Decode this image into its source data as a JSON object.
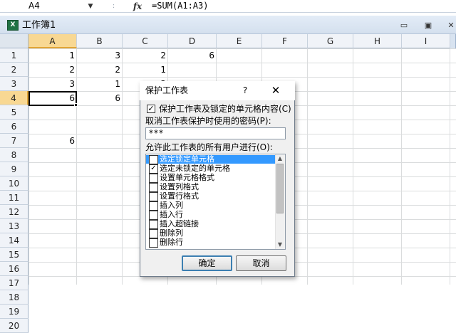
{
  "formula_bar": {
    "name_box": "A4",
    "name_box_arrow": "▼",
    "separator": ":",
    "fx_label": "fx",
    "formula": "=SUM(A1:A3)"
  },
  "window": {
    "title": "工作簿1",
    "icon_letter": "X",
    "minimize": "▭",
    "maximize": "▣",
    "close": "✕"
  },
  "sheet": {
    "columns": [
      "A",
      "B",
      "C",
      "D",
      "E",
      "F",
      "G",
      "H",
      "I"
    ],
    "rows": [
      "1",
      "2",
      "3",
      "4",
      "5",
      "6",
      "7",
      "8",
      "9",
      "10",
      "11",
      "12",
      "13",
      "14",
      "15",
      "16",
      "17",
      "18",
      "19",
      "20"
    ],
    "active_column": "A",
    "active_row": "4",
    "cells": {
      "A1": "1",
      "B1": "3",
      "C1": "2",
      "D1": "6",
      "A2": "2",
      "B2": "2",
      "C2": "1",
      "A3": "3",
      "B3": "1",
      "C3": "3",
      "A4": "6",
      "B4": "6",
      "A7": "6"
    }
  },
  "dialog": {
    "title": "保护工作表",
    "help": "?",
    "close": "✕",
    "protect_checkbox": {
      "checked": true,
      "mark": "✓",
      "label": "保护工作表及锁定的单元格内容(C)"
    },
    "password_label": "取消工作表保护时使用的密码(P):",
    "password_value": "***",
    "allow_label": "允许此工作表的所有用户进行(O):",
    "permissions": [
      {
        "label": "选定锁定单元格",
        "checked": true,
        "mark": "✓",
        "highlighted": true
      },
      {
        "label": "选定未锁定的单元格",
        "checked": true,
        "mark": "✓",
        "highlighted": false
      },
      {
        "label": "设置单元格格式",
        "checked": false,
        "mark": "",
        "highlighted": false
      },
      {
        "label": "设置列格式",
        "checked": false,
        "mark": "",
        "highlighted": false
      },
      {
        "label": "设置行格式",
        "checked": false,
        "mark": "",
        "highlighted": false
      },
      {
        "label": "插入列",
        "checked": false,
        "mark": "",
        "highlighted": false
      },
      {
        "label": "插入行",
        "checked": false,
        "mark": "",
        "highlighted": false
      },
      {
        "label": "插入超链接",
        "checked": false,
        "mark": "",
        "highlighted": false
      },
      {
        "label": "删除列",
        "checked": false,
        "mark": "",
        "highlighted": false
      },
      {
        "label": "删除行",
        "checked": false,
        "mark": "",
        "highlighted": false
      }
    ],
    "scroll_up": "▲",
    "scroll_down": "▼",
    "ok_label": "确定",
    "cancel_label": "取消"
  }
}
